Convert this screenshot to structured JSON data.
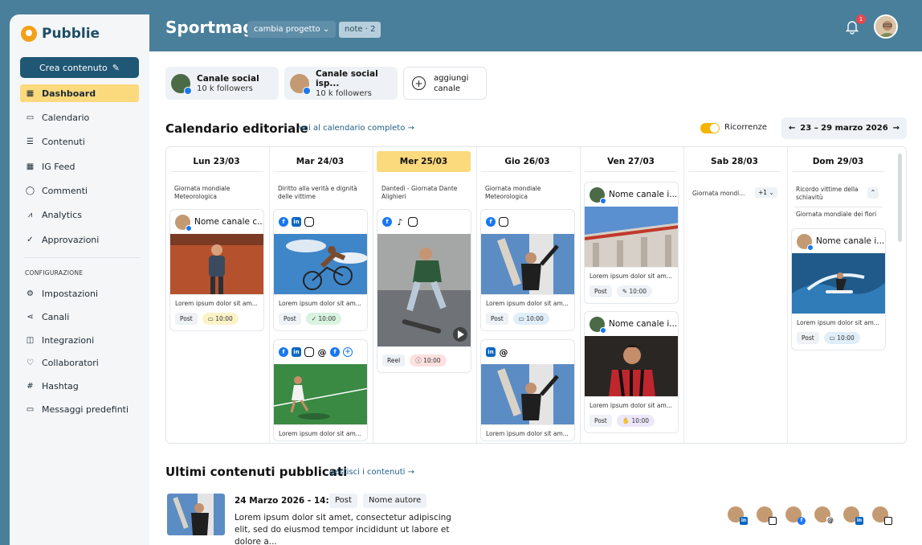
{
  "app": {
    "logo_text": "Pubblie"
  },
  "header": {
    "project_title": "Sportmag",
    "project_switch_label": "cambia progetto",
    "notes_label": "note · 2",
    "notification_count": "1"
  },
  "sidebar": {
    "create_button": "Crea contenuto",
    "main_items": [
      {
        "label": "Dashboard",
        "icon": "grid-icon",
        "active": true
      },
      {
        "label": "Calendario",
        "icon": "calendar-icon"
      },
      {
        "label": "Contenuti",
        "icon": "list-icon"
      },
      {
        "label": "IG Feed",
        "icon": "grid-icon"
      },
      {
        "label": "Commenti",
        "icon": "comment-icon"
      },
      {
        "label": "Analytics",
        "icon": "chart-icon"
      },
      {
        "label": "Approvazioni",
        "icon": "check-circle-icon"
      }
    ],
    "config_section_label": "CONFIGURAZIONE",
    "config_items": [
      {
        "label": "Impostazioni",
        "icon": "gear-icon"
      },
      {
        "label": "Canali",
        "icon": "share-icon"
      },
      {
        "label": "Integrazioni",
        "icon": "puzzle-icon"
      },
      {
        "label": "Collaboratori",
        "icon": "users-icon"
      },
      {
        "label": "Hashtag",
        "icon": "hash-icon"
      },
      {
        "label": "Messaggi predefinti",
        "icon": "message-icon"
      }
    ]
  },
  "channels": [
    {
      "name": "Canale social",
      "followers": "10 k followers"
    },
    {
      "name": "Canale social isp...",
      "followers": "10 k followers"
    }
  ],
  "add_channel_label": "aggiungi canale",
  "calendar": {
    "title": "Calendario editoriale",
    "link": "vai al calendario completo →",
    "recurrence_label": "Ricorrenze",
    "date_range": "23 – 29 marzo 2026",
    "days": [
      {
        "label": "Lun 23/03",
        "ann": "Giornata mondiale Meteorologica"
      },
      {
        "label": "Mar 24/03",
        "ann": "Diritto alla verità e dignità delle vittime"
      },
      {
        "label": "Mer 25/03",
        "ann": "Dantedì - Giornata Dante Alighieri",
        "today": true
      },
      {
        "label": "Gio 26/03",
        "ann": "Giornata mondiale Meteorologica"
      },
      {
        "label": "Ven 27/03",
        "ann": ""
      },
      {
        "label": "Sab 28/03",
        "ann": "Giornata mondi...",
        "extra": "+1"
      },
      {
        "label": "Dom 29/03",
        "ann": "Ricordo vittime della schiavitù",
        "ann2": "Giornata mondiale dei fiori"
      }
    ],
    "post_text": "Lorem ipsum dolor sit am...",
    "channel_label": "Nome canale c...",
    "channel_label_short": "Nome canale i...",
    "type_post": "Post",
    "type_reel": "Reel",
    "time": "10:00"
  },
  "published": {
    "title": "Ultimi contenuti pubblicati",
    "link": "gestisci i contenuti →",
    "date": "24 Marzo 2026 - 14:00",
    "type": "Post",
    "author": "Nome autore",
    "text": "Lorem ipsum dolor sit amet, consectetur adipiscing elit, sed do eiusmod tempor incididunt ut labore et dolore  a..."
  },
  "colors": {
    "brand": "#1f5775",
    "header": "#4a7f9b",
    "accent": "#fbd97d"
  }
}
